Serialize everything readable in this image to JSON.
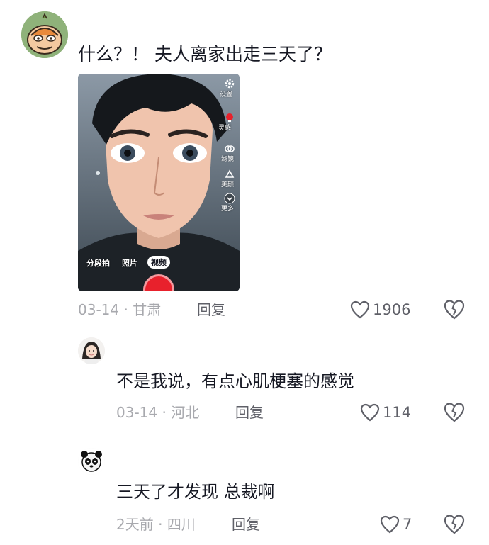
{
  "main_comment": {
    "text": "什么？！ 夫人离家出走三天了？",
    "date": "03-14",
    "location": "甘肃",
    "reply_label": "回复",
    "likes": "1906",
    "video": {
      "settings_label": "设置",
      "side_labels": [
        "灵感",
        "滤镜",
        "美颜",
        "更多"
      ],
      "modes": [
        "分段拍",
        "照片",
        "视频"
      ],
      "active_mode": "视频"
    }
  },
  "replies": [
    {
      "text": "不是我说，有点心肌梗塞的感觉",
      "date": "03-14",
      "location": "河北",
      "reply_label": "回复",
      "likes": "114"
    },
    {
      "text": "三天了才发现 总裁啊",
      "date": "2天前",
      "location": "四川",
      "reply_label": "回复",
      "likes": "7"
    }
  ],
  "separator": "·",
  "colors": {
    "text_primary": "#161823",
    "text_meta": "#a8a9ae",
    "text_action": "#5f6068",
    "record_red": "#e8212c"
  },
  "icons": {
    "like": "heart-outline-icon",
    "dislike": "broken-heart-icon"
  }
}
